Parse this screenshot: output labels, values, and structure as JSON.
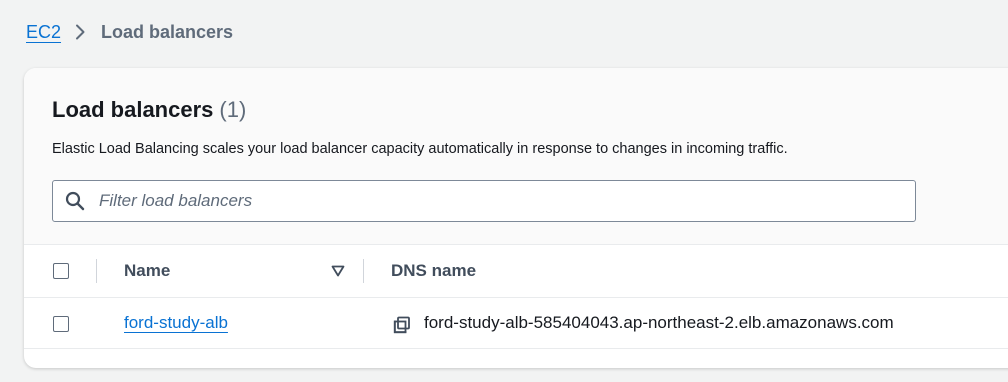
{
  "breadcrumb": {
    "root_label": "EC2",
    "current_label": "Load balancers"
  },
  "panel": {
    "title": "Load balancers",
    "count": "(1)",
    "description": "Elastic Load Balancing scales your load balancer capacity automatically in response to changes in incoming traffic.",
    "filter_placeholder": "Filter load balancers"
  },
  "table": {
    "columns": {
      "name": "Name",
      "dns": "DNS name"
    },
    "rows": [
      {
        "name": "ford-study-alb",
        "dns": "ford-study-alb-585404043.ap-northeast-2.elb.amazonaws.com"
      }
    ]
  },
  "icons": {
    "breadcrumb_separator": "chevron-right-icon",
    "search": "search-icon",
    "sort": "caret-down-icon",
    "copy": "copy-icon"
  },
  "colors": {
    "link": "#0972d3",
    "text": "#16191f",
    "muted": "#5f6b7a",
    "background": "#f2f3f3"
  }
}
